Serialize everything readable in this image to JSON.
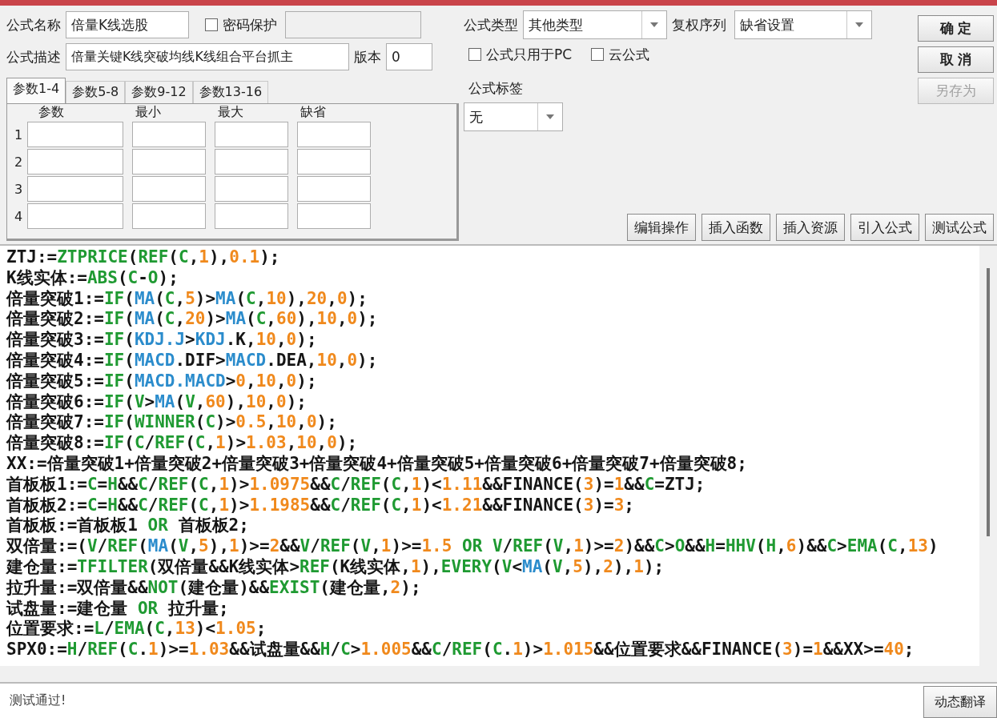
{
  "formula": {
    "name_label": "公式名称",
    "name": "倍量K线选股",
    "password": {
      "label": "密码保护",
      "checked": false
    },
    "desc_label": "公式描述",
    "description": "倍量关键K线突破均线K线组合平台抓主",
    "version_label": "版本",
    "version": "0"
  },
  "params": {
    "tabs": [
      {
        "label": "参数1-4",
        "selected": true
      },
      {
        "label": "参数5-8",
        "selected": false
      },
      {
        "label": "参数9-12",
        "selected": false
      },
      {
        "label": "参数13-16",
        "selected": false
      }
    ],
    "columns": [
      "参数",
      "最小",
      "最大",
      "缺省"
    ],
    "rows": [
      "1",
      "2",
      "3",
      "4"
    ]
  },
  "type": {
    "label": "公式类型",
    "value": "其他类型"
  },
  "adjust": {
    "label": "复权序列",
    "value": "缺省设置"
  },
  "options": [
    {
      "label": "公式只用于PC",
      "checked": false
    },
    {
      "label": "云公式",
      "checked": false
    }
  ],
  "tag": {
    "label": "公式标签",
    "value": "无"
  },
  "side_buttons": [
    {
      "label": "确 定",
      "disabled": false
    },
    {
      "label": "取 消",
      "disabled": false
    },
    {
      "label": "另存为",
      "disabled": true
    }
  ],
  "toolbar": [
    "编辑操作",
    "插入函数",
    "插入资源",
    "引入公式",
    "测试公式"
  ],
  "code_lines": [
    [
      {
        "kind": "plain",
        "text": "ZTJ:="
      },
      {
        "kind": "func",
        "text": "ZTPRICE"
      },
      {
        "kind": "plain",
        "text": "("
      },
      {
        "kind": "func",
        "text": "REF"
      },
      {
        "kind": "plain",
        "text": "("
      },
      {
        "kind": "func",
        "text": "C"
      },
      {
        "kind": "plain",
        "text": ","
      },
      {
        "kind": "num",
        "text": "1"
      },
      {
        "kind": "plain",
        "text": "),"
      },
      {
        "kind": "num",
        "text": "0.1"
      },
      {
        "kind": "plain",
        "text": ");"
      }
    ],
    [
      {
        "kind": "plain",
        "text": "K线实体:="
      },
      {
        "kind": "func",
        "text": "ABS"
      },
      {
        "kind": "plain",
        "text": "("
      },
      {
        "kind": "func",
        "text": "C"
      },
      {
        "kind": "plain",
        "text": "-"
      },
      {
        "kind": "func",
        "text": "O"
      },
      {
        "kind": "plain",
        "text": ");"
      }
    ],
    [
      {
        "kind": "plain",
        "text": "倍量突破1:="
      },
      {
        "kind": "func",
        "text": "IF"
      },
      {
        "kind": "plain",
        "text": "("
      },
      {
        "kind": "ind",
        "text": "MA"
      },
      {
        "kind": "plain",
        "text": "("
      },
      {
        "kind": "func",
        "text": "C"
      },
      {
        "kind": "plain",
        "text": ","
      },
      {
        "kind": "num",
        "text": "5"
      },
      {
        "kind": "plain",
        "text": ")>"
      },
      {
        "kind": "ind",
        "text": "MA"
      },
      {
        "kind": "plain",
        "text": "("
      },
      {
        "kind": "func",
        "text": "C"
      },
      {
        "kind": "plain",
        "text": ","
      },
      {
        "kind": "num",
        "text": "10"
      },
      {
        "kind": "plain",
        "text": "),"
      },
      {
        "kind": "num",
        "text": "20"
      },
      {
        "kind": "plain",
        "text": ","
      },
      {
        "kind": "num",
        "text": "0"
      },
      {
        "kind": "plain",
        "text": ");"
      }
    ],
    [
      {
        "kind": "plain",
        "text": "倍量突破2:="
      },
      {
        "kind": "func",
        "text": "IF"
      },
      {
        "kind": "plain",
        "text": "("
      },
      {
        "kind": "ind",
        "text": "MA"
      },
      {
        "kind": "plain",
        "text": "("
      },
      {
        "kind": "func",
        "text": "C"
      },
      {
        "kind": "plain",
        "text": ","
      },
      {
        "kind": "num",
        "text": "20"
      },
      {
        "kind": "plain",
        "text": ")>"
      },
      {
        "kind": "ind",
        "text": "MA"
      },
      {
        "kind": "plain",
        "text": "("
      },
      {
        "kind": "func",
        "text": "C"
      },
      {
        "kind": "plain",
        "text": ","
      },
      {
        "kind": "num",
        "text": "60"
      },
      {
        "kind": "plain",
        "text": "),"
      },
      {
        "kind": "num",
        "text": "10"
      },
      {
        "kind": "plain",
        "text": ","
      },
      {
        "kind": "num",
        "text": "0"
      },
      {
        "kind": "plain",
        "text": ");"
      }
    ],
    [
      {
        "kind": "plain",
        "text": "倍量突破3:="
      },
      {
        "kind": "func",
        "text": "IF"
      },
      {
        "kind": "plain",
        "text": "("
      },
      {
        "kind": "ind",
        "text": "KDJ.J"
      },
      {
        "kind": "plain",
        "text": ">"
      },
      {
        "kind": "ind",
        "text": "KDJ"
      },
      {
        "kind": "plain",
        "text": ".K,"
      },
      {
        "kind": "num",
        "text": "10"
      },
      {
        "kind": "plain",
        "text": ","
      },
      {
        "kind": "num",
        "text": "0"
      },
      {
        "kind": "plain",
        "text": ");"
      }
    ],
    [
      {
        "kind": "plain",
        "text": "倍量突破4:="
      },
      {
        "kind": "func",
        "text": "IF"
      },
      {
        "kind": "plain",
        "text": "("
      },
      {
        "kind": "ind",
        "text": "MACD"
      },
      {
        "kind": "plain",
        "text": ".DIF>"
      },
      {
        "kind": "ind",
        "text": "MACD"
      },
      {
        "kind": "plain",
        "text": ".DEA,"
      },
      {
        "kind": "num",
        "text": "10"
      },
      {
        "kind": "plain",
        "text": ","
      },
      {
        "kind": "num",
        "text": "0"
      },
      {
        "kind": "plain",
        "text": ");"
      }
    ],
    [
      {
        "kind": "plain",
        "text": "倍量突破5:="
      },
      {
        "kind": "func",
        "text": "IF"
      },
      {
        "kind": "plain",
        "text": "("
      },
      {
        "kind": "ind",
        "text": "MACD.MACD"
      },
      {
        "kind": "plain",
        "text": ">"
      },
      {
        "kind": "num",
        "text": "0"
      },
      {
        "kind": "plain",
        "text": ","
      },
      {
        "kind": "num",
        "text": "10"
      },
      {
        "kind": "plain",
        "text": ","
      },
      {
        "kind": "num",
        "text": "0"
      },
      {
        "kind": "plain",
        "text": ");"
      }
    ],
    [
      {
        "kind": "plain",
        "text": "倍量突破6:="
      },
      {
        "kind": "func",
        "text": "IF"
      },
      {
        "kind": "plain",
        "text": "("
      },
      {
        "kind": "func",
        "text": "V"
      },
      {
        "kind": "plain",
        "text": ">"
      },
      {
        "kind": "ind",
        "text": "MA"
      },
      {
        "kind": "plain",
        "text": "("
      },
      {
        "kind": "func",
        "text": "V"
      },
      {
        "kind": "plain",
        "text": ","
      },
      {
        "kind": "num",
        "text": "60"
      },
      {
        "kind": "plain",
        "text": "),"
      },
      {
        "kind": "num",
        "text": "10"
      },
      {
        "kind": "plain",
        "text": ","
      },
      {
        "kind": "num",
        "text": "0"
      },
      {
        "kind": "plain",
        "text": ");"
      }
    ],
    [
      {
        "kind": "plain",
        "text": "倍量突破7:="
      },
      {
        "kind": "func",
        "text": "IF"
      },
      {
        "kind": "plain",
        "text": "("
      },
      {
        "kind": "func",
        "text": "WINNER"
      },
      {
        "kind": "plain",
        "text": "("
      },
      {
        "kind": "func",
        "text": "C"
      },
      {
        "kind": "plain",
        "text": ")>"
      },
      {
        "kind": "num",
        "text": "0.5"
      },
      {
        "kind": "plain",
        "text": ","
      },
      {
        "kind": "num",
        "text": "10"
      },
      {
        "kind": "plain",
        "text": ","
      },
      {
        "kind": "num",
        "text": "0"
      },
      {
        "kind": "plain",
        "text": ");"
      }
    ],
    [
      {
        "kind": "plain",
        "text": "倍量突破8:="
      },
      {
        "kind": "func",
        "text": "IF"
      },
      {
        "kind": "plain",
        "text": "("
      },
      {
        "kind": "func",
        "text": "C"
      },
      {
        "kind": "plain",
        "text": "/"
      },
      {
        "kind": "func",
        "text": "REF"
      },
      {
        "kind": "plain",
        "text": "("
      },
      {
        "kind": "func",
        "text": "C"
      },
      {
        "kind": "plain",
        "text": ","
      },
      {
        "kind": "num",
        "text": "1"
      },
      {
        "kind": "plain",
        "text": ")>"
      },
      {
        "kind": "num",
        "text": "1.03"
      },
      {
        "kind": "plain",
        "text": ","
      },
      {
        "kind": "num",
        "text": "10"
      },
      {
        "kind": "plain",
        "text": ","
      },
      {
        "kind": "num",
        "text": "0"
      },
      {
        "kind": "plain",
        "text": ");"
      }
    ],
    [
      {
        "kind": "plain",
        "text": "XX:=倍量突破1+倍量突破2+倍量突破3+倍量突破4+倍量突破5+倍量突破6+倍量突破7+倍量突破8;"
      }
    ],
    [
      {
        "kind": "plain",
        "text": "首板板1:="
      },
      {
        "kind": "func",
        "text": "C"
      },
      {
        "kind": "plain",
        "text": "="
      },
      {
        "kind": "func",
        "text": "H"
      },
      {
        "kind": "plain",
        "text": "&&"
      },
      {
        "kind": "func",
        "text": "C"
      },
      {
        "kind": "plain",
        "text": "/"
      },
      {
        "kind": "func",
        "text": "REF"
      },
      {
        "kind": "plain",
        "text": "("
      },
      {
        "kind": "func",
        "text": "C"
      },
      {
        "kind": "plain",
        "text": ","
      },
      {
        "kind": "num",
        "text": "1"
      },
      {
        "kind": "plain",
        "text": ")>"
      },
      {
        "kind": "num",
        "text": "1.0975"
      },
      {
        "kind": "plain",
        "text": "&&"
      },
      {
        "kind": "func",
        "text": "C"
      },
      {
        "kind": "plain",
        "text": "/"
      },
      {
        "kind": "func",
        "text": "REF"
      },
      {
        "kind": "plain",
        "text": "("
      },
      {
        "kind": "func",
        "text": "C"
      },
      {
        "kind": "plain",
        "text": ","
      },
      {
        "kind": "num",
        "text": "1"
      },
      {
        "kind": "plain",
        "text": ")<"
      },
      {
        "kind": "num",
        "text": "1.11"
      },
      {
        "kind": "plain",
        "text": "&&FINANCE("
      },
      {
        "kind": "num",
        "text": "3"
      },
      {
        "kind": "plain",
        "text": ")="
      },
      {
        "kind": "num",
        "text": "1"
      },
      {
        "kind": "plain",
        "text": "&&"
      },
      {
        "kind": "func",
        "text": "C"
      },
      {
        "kind": "plain",
        "text": "=ZTJ;"
      }
    ],
    [
      {
        "kind": "plain",
        "text": "首板板2:="
      },
      {
        "kind": "func",
        "text": "C"
      },
      {
        "kind": "plain",
        "text": "="
      },
      {
        "kind": "func",
        "text": "H"
      },
      {
        "kind": "plain",
        "text": "&&"
      },
      {
        "kind": "func",
        "text": "C"
      },
      {
        "kind": "plain",
        "text": "/"
      },
      {
        "kind": "func",
        "text": "REF"
      },
      {
        "kind": "plain",
        "text": "("
      },
      {
        "kind": "func",
        "text": "C"
      },
      {
        "kind": "plain",
        "text": ","
      },
      {
        "kind": "num",
        "text": "1"
      },
      {
        "kind": "plain",
        "text": ")>"
      },
      {
        "kind": "num",
        "text": "1.1985"
      },
      {
        "kind": "plain",
        "text": "&&"
      },
      {
        "kind": "func",
        "text": "C"
      },
      {
        "kind": "plain",
        "text": "/"
      },
      {
        "kind": "func",
        "text": "REF"
      },
      {
        "kind": "plain",
        "text": "("
      },
      {
        "kind": "func",
        "text": "C"
      },
      {
        "kind": "plain",
        "text": ","
      },
      {
        "kind": "num",
        "text": "1"
      },
      {
        "kind": "plain",
        "text": ")<"
      },
      {
        "kind": "num",
        "text": "1.21"
      },
      {
        "kind": "plain",
        "text": "&&FINANCE("
      },
      {
        "kind": "num",
        "text": "3"
      },
      {
        "kind": "plain",
        "text": ")="
      },
      {
        "kind": "num",
        "text": "3"
      },
      {
        "kind": "plain",
        "text": ";"
      }
    ],
    [
      {
        "kind": "plain",
        "text": "首板板:=首板板1 "
      },
      {
        "kind": "func",
        "text": "OR"
      },
      {
        "kind": "plain",
        "text": " 首板板2;"
      }
    ],
    [
      {
        "kind": "plain",
        "text": "双倍量:=("
      },
      {
        "kind": "func",
        "text": "V"
      },
      {
        "kind": "plain",
        "text": "/"
      },
      {
        "kind": "func",
        "text": "REF"
      },
      {
        "kind": "plain",
        "text": "("
      },
      {
        "kind": "ind",
        "text": "MA"
      },
      {
        "kind": "plain",
        "text": "("
      },
      {
        "kind": "func",
        "text": "V"
      },
      {
        "kind": "plain",
        "text": ","
      },
      {
        "kind": "num",
        "text": "5"
      },
      {
        "kind": "plain",
        "text": "),"
      },
      {
        "kind": "num",
        "text": "1"
      },
      {
        "kind": "plain",
        "text": ")>="
      },
      {
        "kind": "num",
        "text": "2"
      },
      {
        "kind": "plain",
        "text": "&&"
      },
      {
        "kind": "func",
        "text": "V"
      },
      {
        "kind": "plain",
        "text": "/"
      },
      {
        "kind": "func",
        "text": "REF"
      },
      {
        "kind": "plain",
        "text": "("
      },
      {
        "kind": "func",
        "text": "V"
      },
      {
        "kind": "plain",
        "text": ","
      },
      {
        "kind": "num",
        "text": "1"
      },
      {
        "kind": "plain",
        "text": ")>="
      },
      {
        "kind": "num",
        "text": "1.5"
      },
      {
        "kind": "func",
        "text": " OR "
      },
      {
        "kind": "func",
        "text": "V"
      },
      {
        "kind": "plain",
        "text": "/"
      },
      {
        "kind": "func",
        "text": "REF"
      },
      {
        "kind": "plain",
        "text": "("
      },
      {
        "kind": "func",
        "text": "V"
      },
      {
        "kind": "plain",
        "text": ","
      },
      {
        "kind": "num",
        "text": "1"
      },
      {
        "kind": "plain",
        "text": ")>="
      },
      {
        "kind": "num",
        "text": "2"
      },
      {
        "kind": "plain",
        "text": ")&&"
      },
      {
        "kind": "func",
        "text": "C"
      },
      {
        "kind": "plain",
        "text": ">"
      },
      {
        "kind": "func",
        "text": "O"
      },
      {
        "kind": "plain",
        "text": "&&"
      },
      {
        "kind": "func",
        "text": "H"
      },
      {
        "kind": "plain",
        "text": "="
      },
      {
        "kind": "func",
        "text": "HHV"
      },
      {
        "kind": "plain",
        "text": "("
      },
      {
        "kind": "func",
        "text": "H"
      },
      {
        "kind": "plain",
        "text": ","
      },
      {
        "kind": "num",
        "text": "6"
      },
      {
        "kind": "plain",
        "text": ")&&"
      },
      {
        "kind": "func",
        "text": "C"
      },
      {
        "kind": "plain",
        "text": ">"
      },
      {
        "kind": "func",
        "text": "EMA"
      },
      {
        "kind": "plain",
        "text": "("
      },
      {
        "kind": "func",
        "text": "C"
      },
      {
        "kind": "plain",
        "text": ","
      },
      {
        "kind": "num",
        "text": "13"
      },
      {
        "kind": "plain",
        "text": ")"
      }
    ],
    [
      {
        "kind": "plain",
        "text": "建仓量:="
      },
      {
        "kind": "func",
        "text": "TFILTER"
      },
      {
        "kind": "plain",
        "text": "(双倍量&&K线实体>"
      },
      {
        "kind": "func",
        "text": "REF"
      },
      {
        "kind": "plain",
        "text": "(K线实体,"
      },
      {
        "kind": "num",
        "text": "1"
      },
      {
        "kind": "plain",
        "text": "),"
      },
      {
        "kind": "func",
        "text": "EVERY"
      },
      {
        "kind": "plain",
        "text": "("
      },
      {
        "kind": "func",
        "text": "V"
      },
      {
        "kind": "plain",
        "text": "<"
      },
      {
        "kind": "ind",
        "text": "MA"
      },
      {
        "kind": "plain",
        "text": "("
      },
      {
        "kind": "func",
        "text": "V"
      },
      {
        "kind": "plain",
        "text": ","
      },
      {
        "kind": "num",
        "text": "5"
      },
      {
        "kind": "plain",
        "text": "),"
      },
      {
        "kind": "num",
        "text": "2"
      },
      {
        "kind": "plain",
        "text": "),"
      },
      {
        "kind": "num",
        "text": "1"
      },
      {
        "kind": "plain",
        "text": ");"
      }
    ],
    [
      {
        "kind": "plain",
        "text": "拉升量:=双倍量&&"
      },
      {
        "kind": "func",
        "text": "NOT"
      },
      {
        "kind": "plain",
        "text": "(建仓量)&&"
      },
      {
        "kind": "func",
        "text": "EXIST"
      },
      {
        "kind": "plain",
        "text": "(建仓量,"
      },
      {
        "kind": "num",
        "text": "2"
      },
      {
        "kind": "plain",
        "text": ");"
      }
    ],
    [
      {
        "kind": "plain",
        "text": "试盘量:=建仓量 "
      },
      {
        "kind": "func",
        "text": "OR"
      },
      {
        "kind": "plain",
        "text": " 拉升量;"
      }
    ],
    [
      {
        "kind": "plain",
        "text": "位置要求:="
      },
      {
        "kind": "func",
        "text": "L"
      },
      {
        "kind": "plain",
        "text": "/"
      },
      {
        "kind": "func",
        "text": "EMA"
      },
      {
        "kind": "plain",
        "text": "("
      },
      {
        "kind": "func",
        "text": "C"
      },
      {
        "kind": "plain",
        "text": ","
      },
      {
        "kind": "num",
        "text": "13"
      },
      {
        "kind": "plain",
        "text": ")<"
      },
      {
        "kind": "num",
        "text": "1.05"
      },
      {
        "kind": "plain",
        "text": ";"
      }
    ],
    [
      {
        "kind": "plain",
        "text": "SPX0:="
      },
      {
        "kind": "func",
        "text": "H"
      },
      {
        "kind": "plain",
        "text": "/"
      },
      {
        "kind": "func",
        "text": "REF"
      },
      {
        "kind": "plain",
        "text": "("
      },
      {
        "kind": "func",
        "text": "C"
      },
      {
        "kind": "plain",
        "text": "."
      },
      {
        "kind": "num",
        "text": "1"
      },
      {
        "kind": "plain",
        "text": ")>="
      },
      {
        "kind": "num",
        "text": "1.03"
      },
      {
        "kind": "plain",
        "text": "&&试盘量&&"
      },
      {
        "kind": "func",
        "text": "H"
      },
      {
        "kind": "plain",
        "text": "/"
      },
      {
        "kind": "func",
        "text": "C"
      },
      {
        "kind": "plain",
        "text": ">"
      },
      {
        "kind": "num",
        "text": "1.005"
      },
      {
        "kind": "plain",
        "text": "&&"
      },
      {
        "kind": "func",
        "text": "C"
      },
      {
        "kind": "plain",
        "text": "/"
      },
      {
        "kind": "func",
        "text": "REF"
      },
      {
        "kind": "plain",
        "text": "("
      },
      {
        "kind": "func",
        "text": "C"
      },
      {
        "kind": "plain",
        "text": "."
      },
      {
        "kind": "num",
        "text": "1"
      },
      {
        "kind": "plain",
        "text": ")>"
      },
      {
        "kind": "num",
        "text": "1.015"
      },
      {
        "kind": "plain",
        "text": "&&位置要求&&FINANCE("
      },
      {
        "kind": "num",
        "text": "3"
      },
      {
        "kind": "plain",
        "text": ")="
      },
      {
        "kind": "num",
        "text": "1"
      },
      {
        "kind": "plain",
        "text": "&&XX>="
      },
      {
        "kind": "num",
        "text": "40"
      },
      {
        "kind": "plain",
        "text": ";"
      }
    ]
  ],
  "status": {
    "message": "测试通过!",
    "button": "动态翻译"
  }
}
